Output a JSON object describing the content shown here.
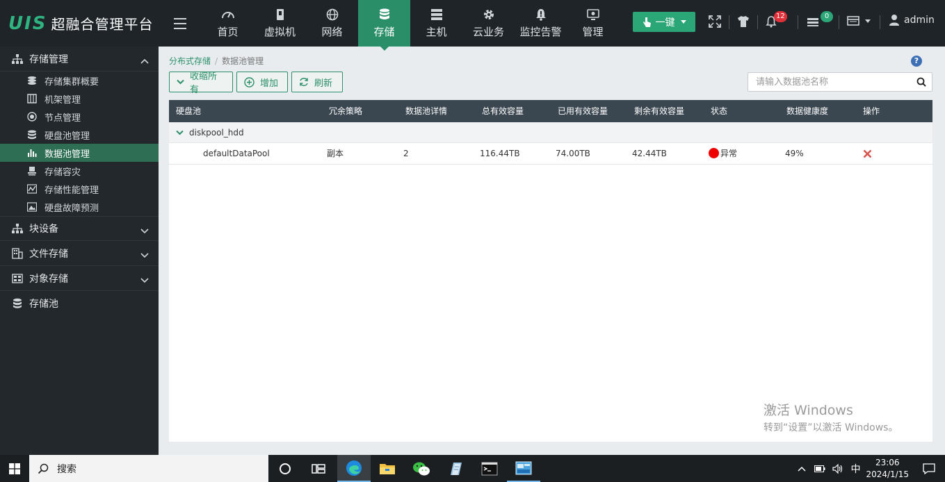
{
  "app": {
    "logo_mark": "UIS",
    "title": "超融合管理平台"
  },
  "nav": [
    {
      "label": "首页",
      "icon": "dashboard-icon"
    },
    {
      "label": "虚拟机",
      "icon": "vm-icon"
    },
    {
      "label": "网络",
      "icon": "globe-icon"
    },
    {
      "label": "存储",
      "icon": "database-icon",
      "active": true
    },
    {
      "label": "主机",
      "icon": "server-icon"
    },
    {
      "label": "云业务",
      "icon": "gear-icon"
    },
    {
      "label": "监控告警",
      "icon": "bell-alert-icon"
    },
    {
      "label": "管理",
      "icon": "monitor-icon"
    }
  ],
  "toolbar": {
    "onekey_label": "一键",
    "alerts_count": "12",
    "tasks_count": "0",
    "user": "admin",
    "alert_badge_color": "#e0303a",
    "task_badge_color": "#2ba676"
  },
  "sidebar": {
    "groups": [
      {
        "label": "存储管理",
        "expanded": true,
        "items": [
          {
            "label": "存储集群概要"
          },
          {
            "label": "机架管理"
          },
          {
            "label": "节点管理"
          },
          {
            "label": "硬盘池管理"
          },
          {
            "label": "数据池管理",
            "active": true
          },
          {
            "label": "存储容灾"
          },
          {
            "label": "存储性能管理"
          },
          {
            "label": "硬盘故障预测"
          }
        ]
      },
      {
        "label": "块设备",
        "expanded": false
      },
      {
        "label": "文件存储",
        "expanded": false
      },
      {
        "label": "对象存储",
        "expanded": false
      },
      {
        "label": "存储池"
      }
    ]
  },
  "breadcrumb": {
    "parent": "分布式存储",
    "current": "数据池管理"
  },
  "actions": {
    "collapse_all": "收缩所有",
    "add": "增加",
    "refresh": "刷新"
  },
  "search": {
    "placeholder": "请输入数据池名称",
    "value": ""
  },
  "table": {
    "columns": [
      "硬盘池",
      "冗余策略",
      "数据池详情",
      "总有效容量",
      "已用有效容量",
      "剩余有效容量",
      "状态",
      "数据健康度",
      "操作"
    ],
    "groups": [
      {
        "name": "diskpool_hdd",
        "rows": [
          {
            "name": "defaultDataPool",
            "redundancy": "副本",
            "detail": "2",
            "total": "116.44TB",
            "used": "74.00TB",
            "remaining": "42.44TB",
            "status": "异常",
            "status_color": "#e00000",
            "health": "49%",
            "action_icon": "delete-x-icon"
          }
        ]
      }
    ]
  },
  "watermark": {
    "line1": "激活 Windows",
    "line2": "转到“设置”以激活 Windows。"
  },
  "taskbar": {
    "search_label": "搜索",
    "ime": "中",
    "time": "23:06",
    "date": "2024/1/15"
  }
}
